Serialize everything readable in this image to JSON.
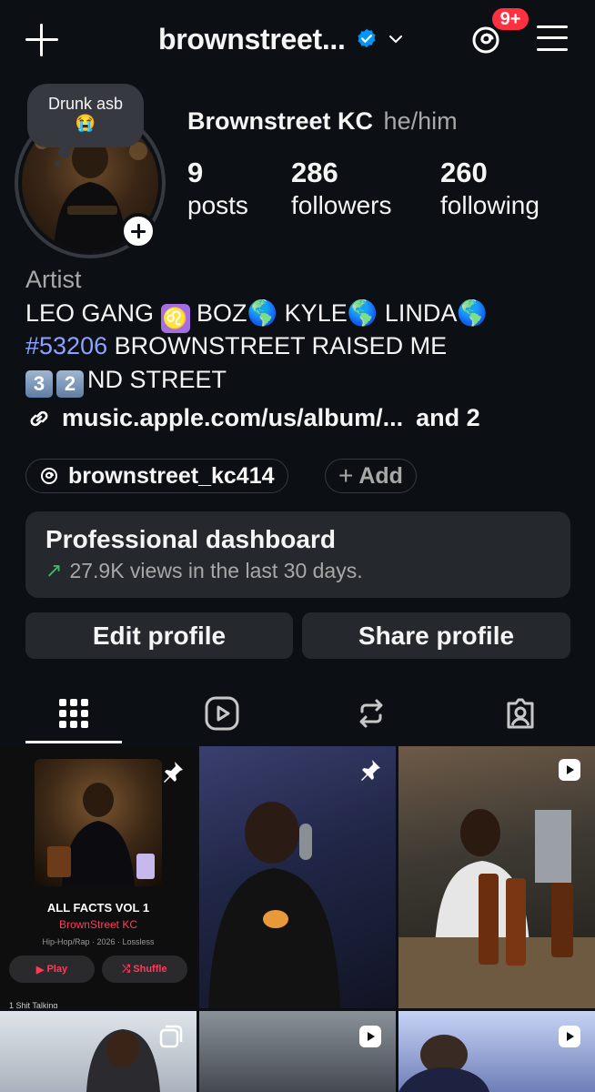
{
  "header": {
    "username": "brownstreet...",
    "notification_badge": "9+"
  },
  "profile": {
    "note_text": "Drunk asb",
    "note_emoji": "😭",
    "full_name": "Brownstreet KC",
    "pronouns": "he/him",
    "stats": [
      {
        "value": "9",
        "label": "posts"
      },
      {
        "value": "286",
        "label": "followers"
      },
      {
        "value": "260",
        "label": "following"
      }
    ],
    "category": "Artist",
    "bio": {
      "line1_a": "LEO GANG ",
      "line1_b": "  BOZ🌎 KYLE🌎 LINDA🌎",
      "hashtag": "#53206",
      "line2_rest": " BROWNSTREET RAISED ME",
      "key1": "3",
      "key2": "2",
      "line3_rest": "ND STREET"
    },
    "link": "music.apple.com/us/album/...",
    "link_more": "and 2",
    "threads_handle": "brownstreet_kc414",
    "add_label": "Add"
  },
  "dashboard": {
    "title": "Professional dashboard",
    "subtitle": "27.9K views in the last 30 days."
  },
  "actions": {
    "edit": "Edit profile",
    "share": "Share profile"
  },
  "tabs": [
    "grid-icon",
    "reels-icon",
    "reposts-icon",
    "tagged-icon"
  ],
  "posts": {
    "album": {
      "title": "ALL FACTS VOL 1",
      "artist": "BrownStreet KC",
      "meta": "Hip-Hop/Rap · 2026 · Lossless",
      "play": "Play",
      "shuffle": "Shuffle",
      "track": "1   Shit Talking"
    }
  },
  "colors": {
    "background": "#0c1014",
    "surface": "#25292e",
    "hashtag": "#8da2ff",
    "badge": "#ff3040",
    "verified": "#0095f6",
    "trend_up": "#3ebc6e"
  }
}
